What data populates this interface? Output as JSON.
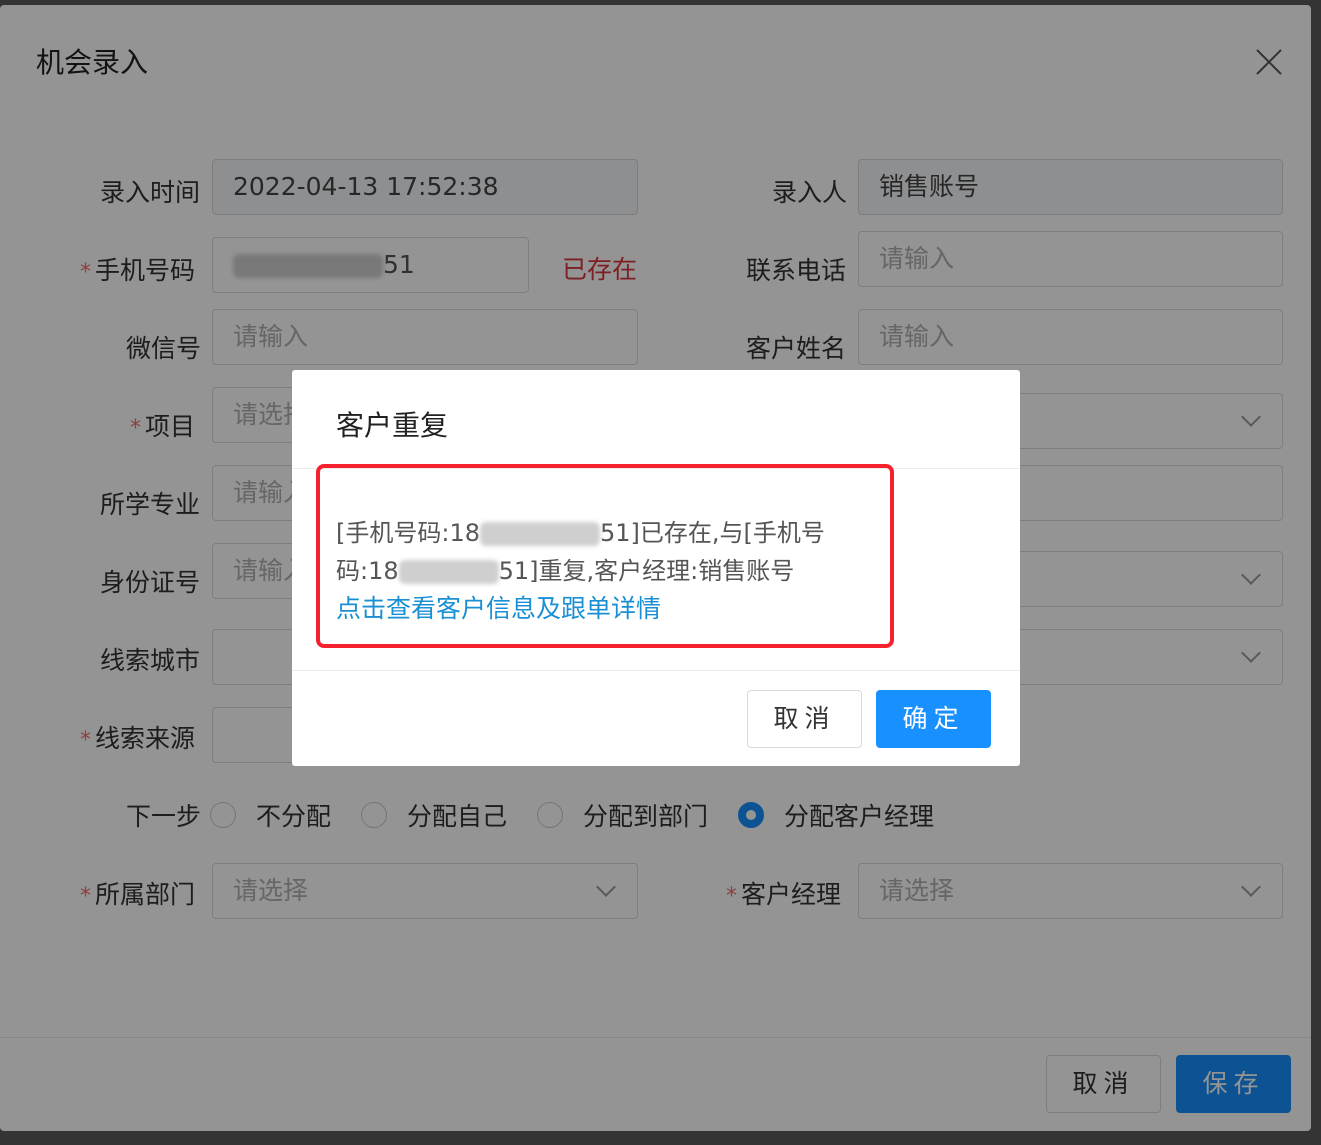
{
  "dialog": {
    "title": "机会录入",
    "save_label": "保存",
    "cancel_label": "取消"
  },
  "form": {
    "entry_time": {
      "label": "录入时间",
      "value": "2022-04-13 17:52:38"
    },
    "entered_by": {
      "label": "录入人",
      "value": "销售账号"
    },
    "phone": {
      "label": "手机号码",
      "value_tail": "51",
      "status": "已存在"
    },
    "contact_phone": {
      "label": "联系电话",
      "placeholder": "请输入"
    },
    "wechat": {
      "label": "微信号",
      "placeholder": "请输入"
    },
    "customer_name": {
      "label": "客户姓名",
      "placeholder": "请输入"
    },
    "project": {
      "label": "项目",
      "placeholder": "请选择"
    },
    "major": {
      "label": "所学专业",
      "placeholder": "请输入"
    },
    "id_number": {
      "label": "身份证号",
      "placeholder": "请输入"
    },
    "lead_city": {
      "label": "线索城市"
    },
    "lead_source": {
      "label": "线索来源"
    },
    "next_step": {
      "label": "下一步",
      "options": [
        "不分配",
        "分配自己",
        "分配到部门",
        "分配客户经理"
      ],
      "selected": "分配客户经理"
    },
    "department": {
      "label": "所属部门",
      "placeholder": "请选择"
    },
    "account_manager": {
      "label": "客户经理",
      "placeholder": "请选择"
    }
  },
  "modal": {
    "title": "客户重复",
    "line1_a": "[手机号码:18",
    "line1_b": "51]已存在,与[手机号",
    "line2_a": "码:18",
    "line2_b": "51]重复,客户经理:销售账号",
    "link": "点击查看客户信息及跟单详情",
    "cancel_label": "取消",
    "ok_label": "确定"
  },
  "colors": {
    "primary": "#1890ff",
    "danger": "#f5222d",
    "link": "#1a8fd4"
  }
}
